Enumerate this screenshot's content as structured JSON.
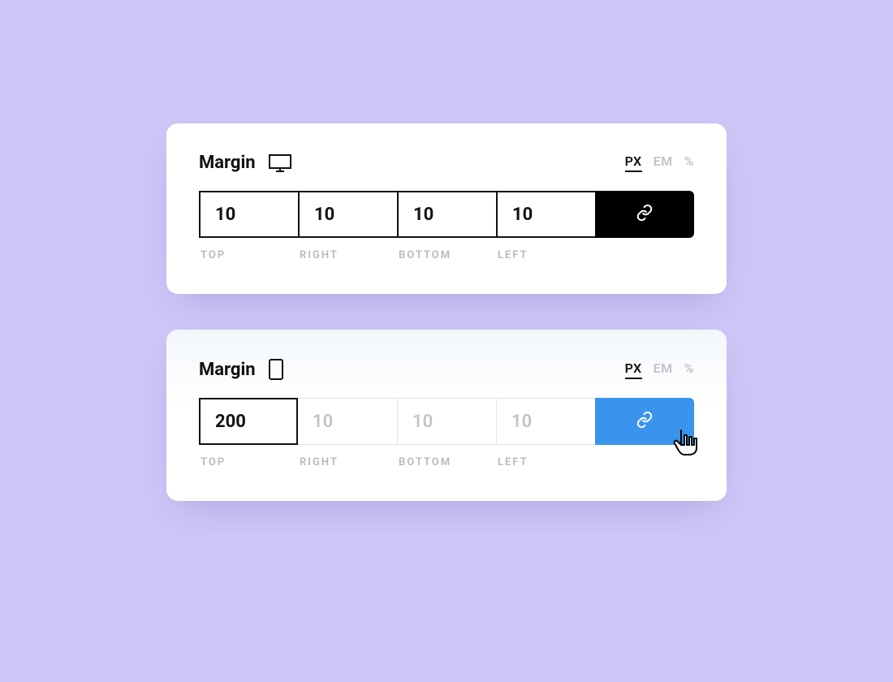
{
  "panels": [
    {
      "title": "Margin",
      "device": "desktop",
      "units": {
        "px": "PX",
        "em": "EM",
        "pct": "%"
      },
      "active_unit": "PX",
      "values": {
        "top": "10",
        "right": "10",
        "bottom": "10",
        "left": "10"
      },
      "linked": true,
      "link_color": "#000000"
    },
    {
      "title": "Margin",
      "device": "mobile",
      "units": {
        "px": "PX",
        "em": "EM",
        "pct": "%"
      },
      "active_unit": "PX",
      "values": {
        "top": "200",
        "right": "10",
        "bottom": "10",
        "left": "10"
      },
      "linked": false,
      "link_color": "#3a94ee",
      "hover": true
    }
  ],
  "labels": {
    "top": "TOP",
    "right": "RIGHT",
    "bottom": "BOTTOM",
    "left": "LEFT"
  }
}
